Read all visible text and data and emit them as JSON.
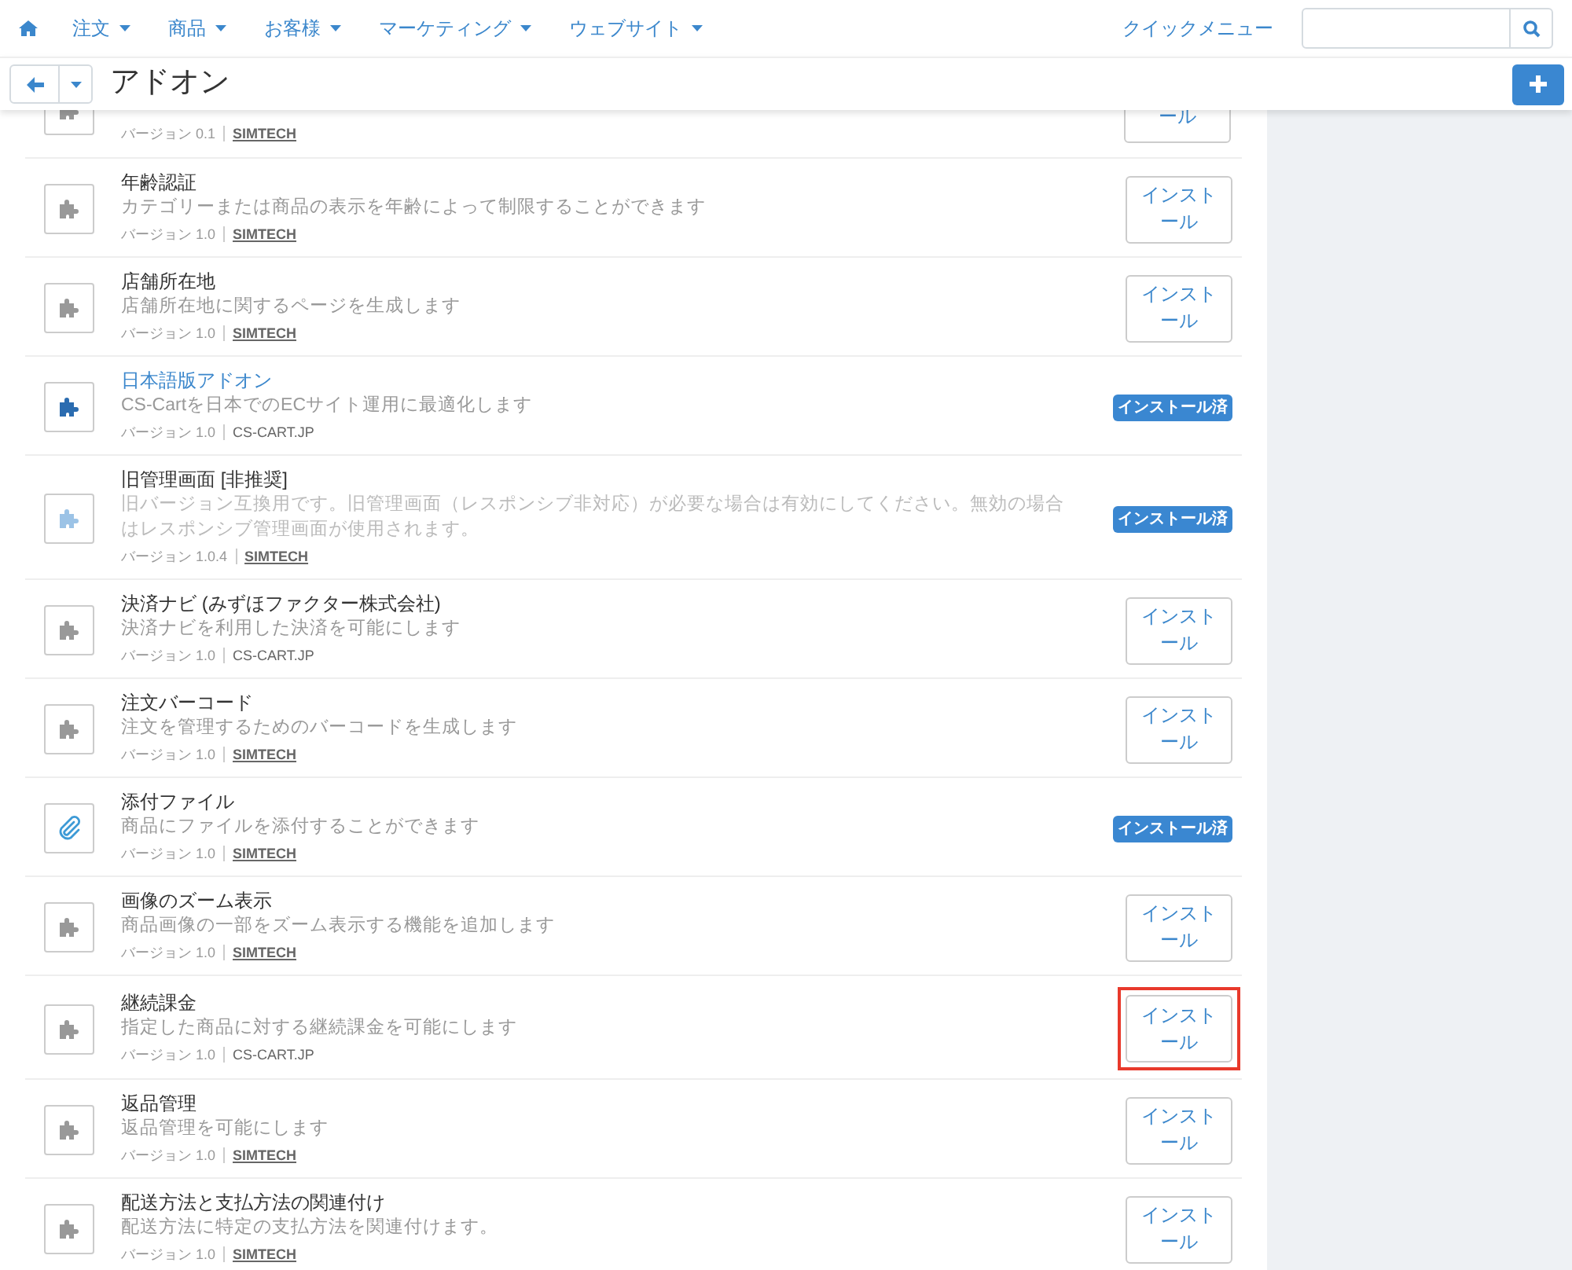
{
  "nav": {
    "items": [
      {
        "label": "注文"
      },
      {
        "label": "商品"
      },
      {
        "label": "お客様"
      },
      {
        "label": "マーケティング"
      },
      {
        "label": "ウェブサイト"
      }
    ],
    "quick_menu": "クイックメニュー"
  },
  "toolbar": {
    "title": "アドオン"
  },
  "partial_addon": {
    "version": "バージョン 0.1",
    "author": "SIMTECH",
    "button": "ール"
  },
  "addons": [
    {
      "title": "年齢認証",
      "description": "カテゴリーまたは商品の表示を年齢によって制限することができます",
      "version": "バージョン 1.0",
      "author": "SIMTECH",
      "author_link": true,
      "kind": "puzzle",
      "linked": false,
      "dimmed": false,
      "installed": false,
      "action": "インストール",
      "highlighted": false
    },
    {
      "title": "店舗所在地",
      "description": "店舗所在地に関するページを生成します",
      "version": "バージョン 1.0",
      "author": "SIMTECH",
      "author_link": true,
      "kind": "puzzle",
      "linked": false,
      "dimmed": false,
      "installed": false,
      "action": "インストール",
      "highlighted": false
    },
    {
      "title": "日本語版アドオン",
      "description": "CS-Cartを日本でのECサイト運用に最適化します",
      "version": "バージョン 1.0",
      "author": "CS-CART.JP",
      "author_link": false,
      "kind": "puzzle",
      "linked": true,
      "dimmed": false,
      "installed": true,
      "action": "インストール済"
    },
    {
      "title": "旧管理画面 [非推奨]",
      "description": "旧バージョン互換用です。旧管理画面（レスポンシブ非対応）が必要な場合は有効にしてください。無効の場合はレスポンシブ管理画面が使用されます。",
      "version": "バージョン 1.0.4",
      "author": "SIMTECH",
      "author_link": true,
      "kind": "puzzle",
      "linked": false,
      "dimmed": true,
      "installed": true,
      "action": "インストール済"
    },
    {
      "title": "決済ナビ (みずほファクター株式会社)",
      "description": "決済ナビを利用した決済を可能にします",
      "version": "バージョン 1.0",
      "author": "CS-CART.JP",
      "author_link": false,
      "kind": "puzzle",
      "linked": false,
      "dimmed": false,
      "installed": false,
      "action": "インストール",
      "highlighted": false
    },
    {
      "title": "注文バーコード",
      "description": "注文を管理するためのバーコードを生成します",
      "version": "バージョン 1.0",
      "author": "SIMTECH",
      "author_link": true,
      "kind": "puzzle",
      "linked": false,
      "dimmed": false,
      "installed": false,
      "action": "インストール",
      "highlighted": false
    },
    {
      "title": "添付ファイル",
      "description": "商品にファイルを添付することができます",
      "version": "バージョン 1.0",
      "author": "SIMTECH",
      "author_link": true,
      "kind": "paperclip",
      "linked": false,
      "dimmed": false,
      "installed": true,
      "action": "インストール済"
    },
    {
      "title": "画像のズーム表示",
      "description": "商品画像の一部をズーム表示する機能を追加します",
      "version": "バージョン 1.0",
      "author": "SIMTECH",
      "author_link": true,
      "kind": "puzzle",
      "linked": false,
      "dimmed": false,
      "installed": false,
      "action": "インストール",
      "highlighted": false
    },
    {
      "title": "継続課金",
      "description": "指定した商品に対する継続課金を可能にします",
      "version": "バージョン 1.0",
      "author": "CS-CART.JP",
      "author_link": false,
      "kind": "puzzle",
      "linked": false,
      "dimmed": false,
      "installed": false,
      "action": "インストール",
      "highlighted": true
    },
    {
      "title": "返品管理",
      "description": "返品管理を可能にします",
      "version": "バージョン 1.0",
      "author": "SIMTECH",
      "author_link": true,
      "kind": "puzzle",
      "linked": false,
      "dimmed": false,
      "installed": false,
      "action": "インストール",
      "highlighted": false
    },
    {
      "title": "配送方法と支払方法の関連付け",
      "description": "配送方法に特定の支払方法を関連付けます。",
      "version": "バージョン 1.0",
      "author": "SIMTECH",
      "author_link": true,
      "kind": "puzzle",
      "linked": false,
      "dimmed": false,
      "installed": false,
      "action": "インストール",
      "highlighted": false
    }
  ]
}
